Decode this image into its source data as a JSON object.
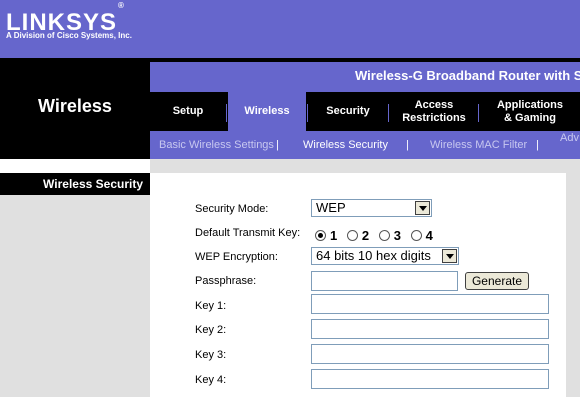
{
  "brand": {
    "logo": "LINKSYS",
    "logo_mark": "®",
    "subtitle": "A Division of Cisco Systems, Inc."
  },
  "product": {
    "title": "Wireless-G Broadband Router with Sp"
  },
  "section": {
    "label": "Wireless"
  },
  "tabs": [
    {
      "label": "Setup"
    },
    {
      "label_line1": "Wireless"
    },
    {
      "label": "Security"
    },
    {
      "label_line1": "Access",
      "label_line2": "Restrictions"
    },
    {
      "label_line1": "Applications",
      "label_line2": "& Gaming"
    }
  ],
  "subtabs": {
    "basic": "Basic Wireless Settings",
    "security": "Wireless Security",
    "mac": "Wireless MAC Filter",
    "advanced": "Adv",
    "separator": "|"
  },
  "left_heading": "Wireless Security",
  "form": {
    "security_mode_label": "Security Mode:",
    "security_mode_value": "WEP",
    "default_key_label": "Default Transmit  Key:",
    "default_key_options": [
      "1",
      "2",
      "3",
      "4"
    ],
    "default_key_selected": "1",
    "wep_encryption_label": "WEP Encryption:",
    "wep_encryption_value": "64 bits 10 hex digits",
    "passphrase_label": "Passphrase:",
    "passphrase_value": "",
    "generate_button": "Generate",
    "key1_label": "Key 1:",
    "key2_label": "Key 2:",
    "key3_label": "Key 3:",
    "key4_label": "Key 4:",
    "key1_value": "",
    "key2_value": "",
    "key3_value": "",
    "key4_value": ""
  },
  "colors": {
    "brand_purple": "#6666cc",
    "black": "#000000",
    "panel_grey": "#e0e0e0"
  }
}
